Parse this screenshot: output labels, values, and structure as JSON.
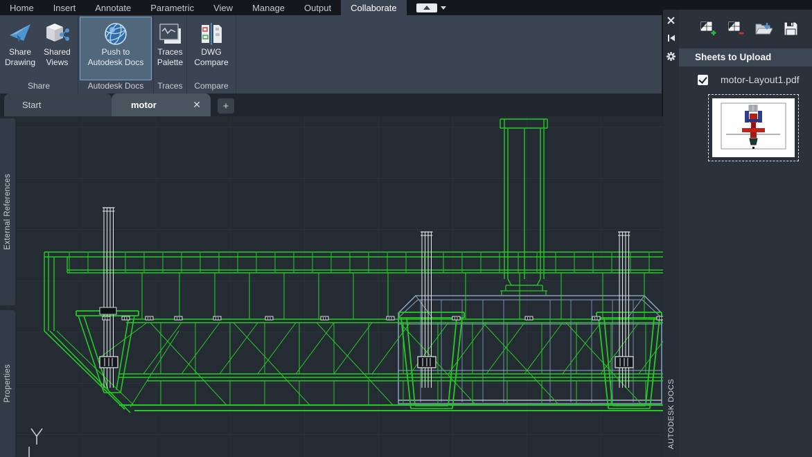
{
  "menubar": {
    "items": [
      {
        "label": "Home",
        "active": false
      },
      {
        "label": "Insert",
        "active": false
      },
      {
        "label": "Annotate",
        "active": false
      },
      {
        "label": "Parametric",
        "active": false
      },
      {
        "label": "View",
        "active": false
      },
      {
        "label": "Manage",
        "active": false
      },
      {
        "label": "Output",
        "active": false
      },
      {
        "label": "Collaborate",
        "active": true
      }
    ]
  },
  "ribbon": {
    "groups": [
      {
        "label": "Share",
        "buttons": [
          {
            "line1": "Share",
            "line2": "Drawing",
            "icon": "paper-plane-icon"
          },
          {
            "line1": "Shared",
            "line2": "Views",
            "icon": "cube-share-icon"
          }
        ]
      },
      {
        "label": "Autodesk Docs",
        "buttons": [
          {
            "line1": "Push to",
            "line2": "Autodesk Docs",
            "icon": "globe-icon",
            "active": true
          }
        ]
      },
      {
        "label": "Traces",
        "buttons": [
          {
            "line1": "Traces",
            "line2": "Palette",
            "icon": "traces-palette-icon"
          }
        ]
      },
      {
        "label": "Compare",
        "buttons": [
          {
            "line1": "DWG",
            "line2": "Compare",
            "icon": "dwg-compare-icon"
          }
        ]
      }
    ]
  },
  "file_tabs": {
    "tabs": [
      {
        "label": "Start",
        "active": false
      },
      {
        "label": "motor",
        "active": true,
        "close_glyph": "✕"
      }
    ],
    "new_tab_glyph": "+"
  },
  "left_palette_tabs": [
    {
      "label": "External References"
    },
    {
      "label": "Properties"
    }
  ],
  "docs_panel": {
    "vertical_title": "AUTODESK DOCS",
    "titlebar_icons": [
      "close-icon",
      "auto-hide-icon",
      "properties-icon"
    ],
    "toolbar_icons": [
      "add-sheets-icon",
      "remove-sheets-icon",
      "open-icon",
      "save-icon"
    ],
    "header": "Sheets to Upload",
    "sheets": [
      {
        "name": "motor-Layout1.pdf",
        "checked": true
      }
    ]
  },
  "colors": {
    "ribbon_background": "#3b4452",
    "active_button_border": "#7ba7cc",
    "wireframe_green": "#24cb24",
    "wireframe_blue": "#9db4d6",
    "wireframe_white": "#e6e8ea",
    "canvas_background": "#242b32",
    "accent_blue": "#4f96d1"
  }
}
